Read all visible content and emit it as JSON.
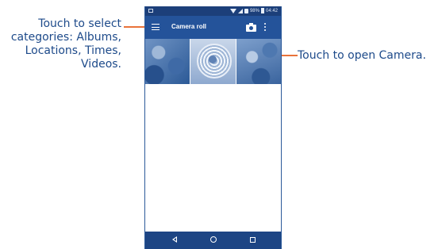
{
  "callouts": {
    "left": {
      "lines": [
        "Touch to select",
        "categories: Albums,",
        "Locations, Times,",
        "Videos."
      ]
    },
    "right": {
      "text": "Touch to open Camera."
    }
  },
  "colors": {
    "callout_text": "#1d4a8a",
    "leader": "#e9733a",
    "status_bar": "#1c3f7a",
    "app_bar": "#24539a",
    "nav_bar": "#1d4584"
  },
  "status_bar": {
    "battery": "98%",
    "time": "04:42"
  },
  "app_bar": {
    "title": "Camera roll",
    "icons": [
      "menu-icon",
      "camera-icon",
      "overflow-icon"
    ]
  },
  "thumbnails": [
    {
      "icon": "photo-flowers"
    },
    {
      "icon": "photo-fan"
    },
    {
      "icon": "photo-leaves"
    }
  ],
  "nav_bar": {
    "icons": [
      "back-icon",
      "home-icon",
      "recents-icon"
    ]
  }
}
